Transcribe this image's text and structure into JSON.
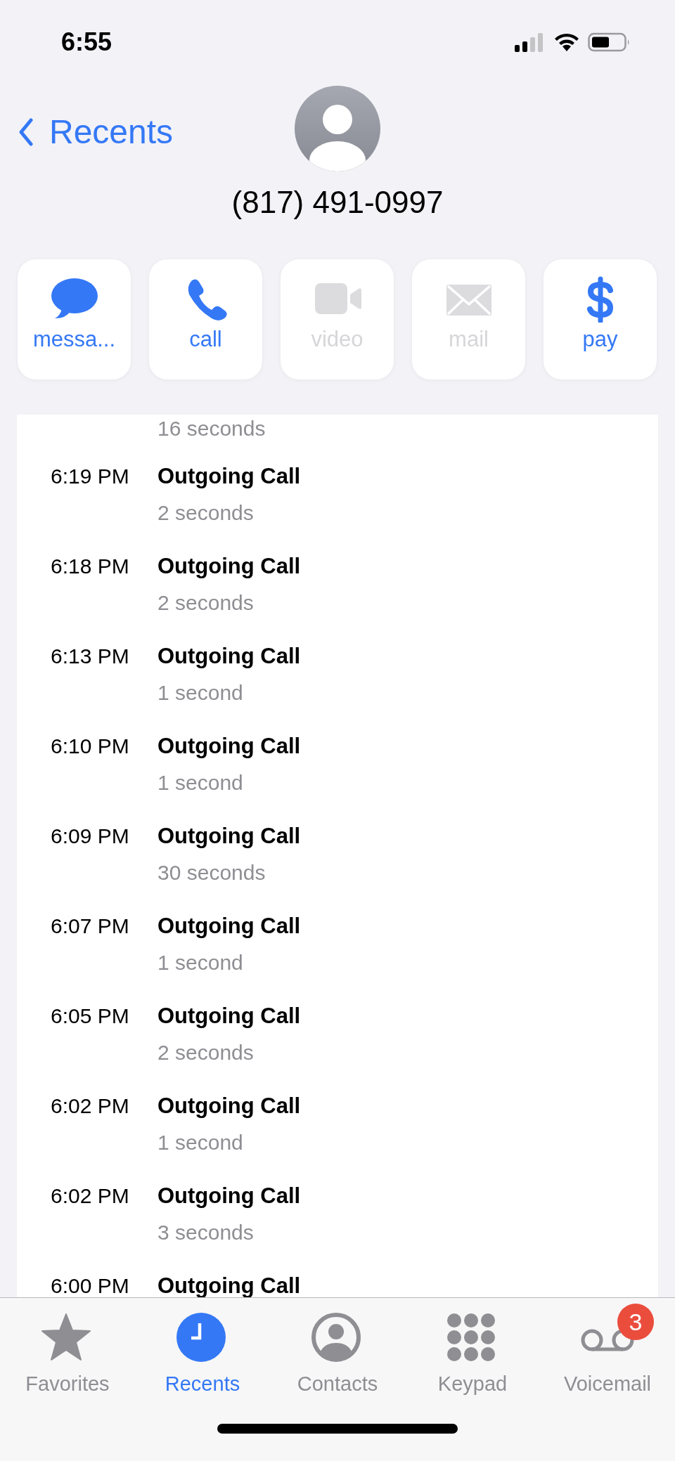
{
  "status_bar": {
    "time": "6:55"
  },
  "nav": {
    "back_label": "Recents"
  },
  "contact": {
    "number": "(817) 491-0997"
  },
  "actions": [
    {
      "kind": "message",
      "label": "messa...",
      "disabled": false
    },
    {
      "kind": "call",
      "label": "call",
      "disabled": false
    },
    {
      "kind": "video",
      "label": "video",
      "disabled": true
    },
    {
      "kind": "mail",
      "label": "mail",
      "disabled": true
    },
    {
      "kind": "pay",
      "label": "pay",
      "disabled": false
    }
  ],
  "call_log": [
    {
      "duration": "16 seconds"
    },
    {
      "time": "6:19 PM",
      "type": "Outgoing Call",
      "duration": "2 seconds"
    },
    {
      "time": "6:18 PM",
      "type": "Outgoing Call",
      "duration": "2 seconds"
    },
    {
      "time": "6:13 PM",
      "type": "Outgoing Call",
      "duration": "1 second"
    },
    {
      "time": "6:10 PM",
      "type": "Outgoing Call",
      "duration": "1 second"
    },
    {
      "time": "6:09 PM",
      "type": "Outgoing Call",
      "duration": "30 seconds"
    },
    {
      "time": "6:07 PM",
      "type": "Outgoing Call",
      "duration": "1 second"
    },
    {
      "time": "6:05 PM",
      "type": "Outgoing Call",
      "duration": "2 seconds"
    },
    {
      "time": "6:02 PM",
      "type": "Outgoing Call",
      "duration": "1 second"
    },
    {
      "time": "6:02 PM",
      "type": "Outgoing Call",
      "duration": "3 seconds"
    },
    {
      "time": "6:00 PM",
      "type": "Outgoing Call"
    }
  ],
  "tab_bar": [
    {
      "kind": "favorites",
      "label": "Favorites",
      "selected": false
    },
    {
      "kind": "recents",
      "label": "Recents",
      "selected": true
    },
    {
      "kind": "contacts",
      "label": "Contacts",
      "selected": false
    },
    {
      "kind": "keypad",
      "label": "Keypad",
      "selected": false
    },
    {
      "kind": "voicemail",
      "label": "Voicemail",
      "selected": false,
      "badge": "3"
    }
  ]
}
